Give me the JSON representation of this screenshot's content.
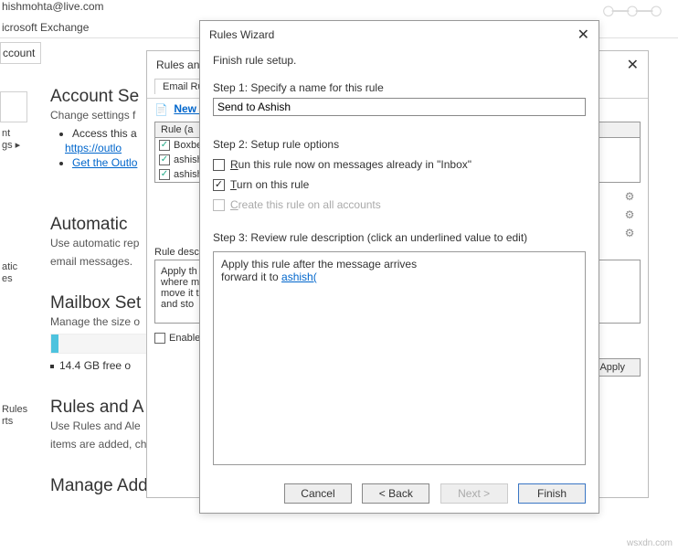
{
  "top": {
    "email": "hishmohta@live.com",
    "exchange": "icrosoft Exchange",
    "ccount": "ccount"
  },
  "leftIcons": {
    "nt": "nt",
    "gs": "gs ▸",
    "atic": "atic",
    "es": "es",
    "rules": "Rules",
    "rts": "rts"
  },
  "sections": {
    "account": {
      "title": "Account Se",
      "sub": "Change settings f",
      "b1": "Access this a",
      "link1": "https://outlo",
      "b2": "Get the Outlo"
    },
    "automatic": {
      "title": "Automatic",
      "sub": "Use automatic rep",
      "sub2": "email messages."
    },
    "mailbox": {
      "title": "Mailbox Set",
      "sub": "Manage the size o",
      "free": "14.4 GB free o"
    },
    "rules": {
      "title": "Rules and A",
      "sub": "Use Rules and Ale",
      "sub2": "items are added, changed, or r"
    },
    "addins": {
      "title": "Manage Add-ins"
    }
  },
  "dlgRules": {
    "title": "Rules and A",
    "tab": "Email Rule",
    "newRule": "New R",
    "hdr": "Rule (a",
    "rows": [
      "Boxbe",
      "ashish",
      "ashish"
    ],
    "descLabel": "Rule descr",
    "desc1": "Apply th",
    "desc2": "where m",
    "desc3": "move it t",
    "desc4": "and sto",
    "enable": "Enable",
    "apply": "Apply"
  },
  "wizard": {
    "title": "Rules Wizard",
    "heading": "Finish rule setup.",
    "step1": "Step 1: Specify a name for this rule",
    "ruleName": "Send to Ashish",
    "step2": "Step 2: Setup rule options",
    "runNow_pre": "R",
    "runNow_post": "un this rule now on messages already in \"Inbox\"",
    "turnOn_pre": "T",
    "turnOn_post": "urn on this rule",
    "allAcct_pre": "C",
    "allAcct_post": "reate this rule on all accounts",
    "step3": "Step 3: Review rule description (click an underlined value to edit)",
    "review1": "Apply this rule after the message arrives",
    "review2_pre": "forward it to ",
    "review2_link": "ashish(",
    "cancel": "Cancel",
    "back": "<  Back",
    "next": "Next >",
    "finish": "Finish"
  },
  "watermark": "wsxdn.com"
}
